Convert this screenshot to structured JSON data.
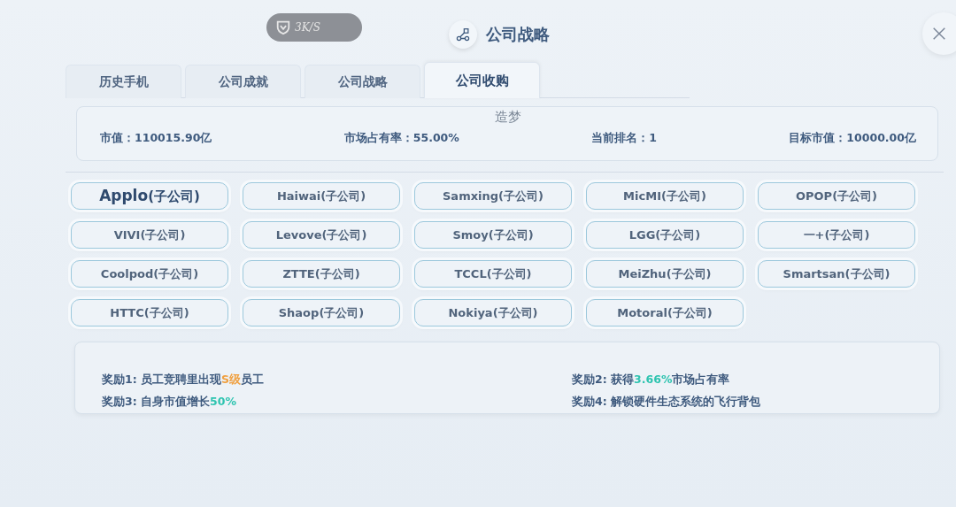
{
  "speed_badge": {
    "text": "3K/S"
  },
  "window": {
    "title": "公司战略"
  },
  "tabs": [
    {
      "label": "历史手机",
      "selected": false
    },
    {
      "label": "公司成就",
      "selected": false
    },
    {
      "label": "公司战略",
      "selected": false
    },
    {
      "label": "公司收购",
      "selected": true
    }
  ],
  "summary": {
    "name": "造梦",
    "stats": [
      {
        "label": "市值：",
        "value": "110015.90亿"
      },
      {
        "label": "市场占有率：",
        "value": "55.00%"
      },
      {
        "label": "当前排名：",
        "value": "1"
      },
      {
        "label": "目标市值：",
        "value": "10000.00亿"
      }
    ]
  },
  "companies": [
    {
      "name": "Applo",
      "suffix": "(子公司)",
      "selected": true
    },
    {
      "name": "Haiwai",
      "suffix": "(子公司)",
      "selected": false
    },
    {
      "name": "Samxing",
      "suffix": "(子公司)",
      "selected": false
    },
    {
      "name": "MicMI",
      "suffix": "(子公司)",
      "selected": false
    },
    {
      "name": "OPOP",
      "suffix": "(子公司)",
      "selected": false
    },
    {
      "name": "VIVI",
      "suffix": "(子公司)",
      "selected": false
    },
    {
      "name": "Levove",
      "suffix": "(子公司)",
      "selected": false
    },
    {
      "name": "Smoy",
      "suffix": "(子公司)",
      "selected": false
    },
    {
      "name": "LGG",
      "suffix": "(子公司)",
      "selected": false
    },
    {
      "name": "一+",
      "suffix": "(子公司)",
      "selected": false
    },
    {
      "name": "Coolpod",
      "suffix": "(子公司)",
      "selected": false
    },
    {
      "name": "ZTTE",
      "suffix": "(子公司)",
      "selected": false
    },
    {
      "name": "TCCL",
      "suffix": "(子公司)",
      "selected": false
    },
    {
      "name": "MeiZhu",
      "suffix": "(子公司)",
      "selected": false
    },
    {
      "name": "Smartsan",
      "suffix": "(子公司)",
      "selected": false
    },
    {
      "name": "HTTC",
      "suffix": "(子公司)",
      "selected": false
    },
    {
      "name": "Shaop",
      "suffix": "(子公司)",
      "selected": false
    },
    {
      "name": "Nokiya",
      "suffix": "(子公司)",
      "selected": false
    },
    {
      "name": "Motoral",
      "suffix": "(子公司)",
      "selected": false
    }
  ],
  "rewards": [
    {
      "parts": [
        {
          "text": "奖励1: 员工竞聘里出现"
        },
        {
          "text": "S级",
          "color": "#f0a040"
        },
        {
          "text": "员工"
        }
      ]
    },
    {
      "parts": [
        {
          "text": "奖励2: 获得"
        },
        {
          "text": "3.66%",
          "color": "#2fc4b0"
        },
        {
          "text": "市场占有率"
        }
      ]
    },
    {
      "parts": [
        {
          "text": "奖励3: 自身市值增长"
        },
        {
          "text": "50%",
          "color": "#2fc4b0"
        }
      ]
    },
    {
      "parts": [
        {
          "text": "奖励4: 解锁硬件生态系统的飞行背包"
        }
      ]
    }
  ]
}
